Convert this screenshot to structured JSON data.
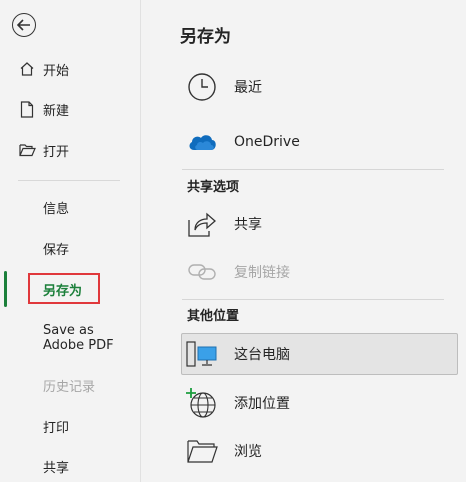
{
  "sidebar": {
    "items": [
      {
        "label": "开始"
      },
      {
        "label": "新建"
      },
      {
        "label": "打开"
      },
      {
        "label": "信息"
      },
      {
        "label": "保存"
      },
      {
        "label": "另存为"
      },
      {
        "label": "Save as"
      },
      {
        "label": "Adobe PDF"
      },
      {
        "label": "历史记录"
      },
      {
        "label": "打印"
      },
      {
        "label": "共享"
      }
    ]
  },
  "main": {
    "title": "另存为",
    "options": [
      {
        "label": "最近",
        "icon": "clock-icon"
      },
      {
        "label": "OneDrive",
        "icon": "onedrive-cloud-icon"
      }
    ],
    "share_heading": "共享选项",
    "share_options": [
      {
        "label": "共享",
        "icon": "share-icon"
      },
      {
        "label": "复制链接",
        "icon": "link-icon"
      }
    ],
    "other_heading": "其他位置",
    "other_options": [
      {
        "label": "这台电脑",
        "icon": "pc-icon"
      },
      {
        "label": "添加位置",
        "icon": "globe-add-icon"
      },
      {
        "label": "浏览",
        "icon": "folder-icon"
      }
    ]
  },
  "colors": {
    "accent": "#1b7f3a",
    "highlight_box": "#e0383b",
    "onedrive": "#0f6cbd"
  }
}
